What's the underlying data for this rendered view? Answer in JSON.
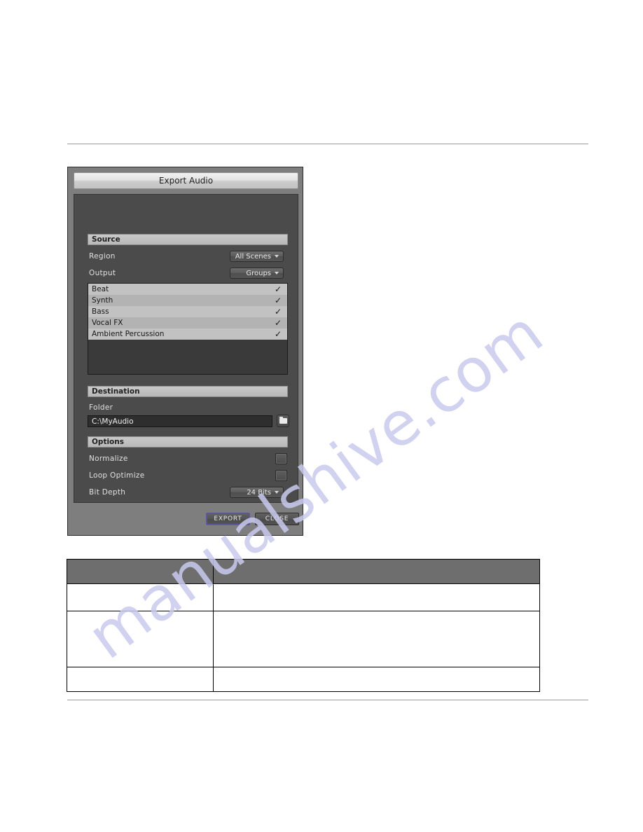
{
  "watermark": {
    "text": "manualshive.com",
    "color": "#c9c9ee"
  },
  "dialog": {
    "title": "Export Audio",
    "sections": {
      "source": {
        "header": "Source",
        "region": {
          "label": "Region",
          "value": "All Scenes",
          "caret_icon": "chevron-down-icon"
        },
        "output": {
          "label": "Output",
          "value": "Groups",
          "caret_icon": "chevron-down-icon"
        },
        "group_list": [
          {
            "name": "Beat",
            "checked": true,
            "check_icon": "checkmark-icon"
          },
          {
            "name": "Synth",
            "checked": true,
            "check_icon": "checkmark-icon"
          },
          {
            "name": "Bass",
            "checked": true,
            "check_icon": "checkmark-icon"
          },
          {
            "name": "Vocal FX",
            "checked": true,
            "check_icon": "checkmark-icon"
          },
          {
            "name": "Ambient Percussion",
            "checked": true,
            "check_icon": "checkmark-icon"
          }
        ]
      },
      "destination": {
        "header": "Destination",
        "folder": {
          "label": "Folder",
          "value": "C:\\MyAudio",
          "browse_icon": "folder-icon"
        }
      },
      "options": {
        "header": "Options",
        "normalize": {
          "label": "Normalize",
          "checked": false
        },
        "loop_optimize": {
          "label": "Loop Optimize",
          "checked": false
        },
        "bit_depth": {
          "label": "Bit Depth",
          "value": "24 Bits",
          "caret_icon": "chevron-down-icon"
        }
      }
    },
    "progress": {
      "percent": 0
    },
    "footer": {
      "export_label": "EXPORT",
      "close_label": "CLOSE",
      "export_focus_color": "#5a56a0"
    }
  },
  "table": {
    "headers": [
      "",
      ""
    ],
    "rows": [
      [
        "",
        ""
      ],
      [
        "",
        ""
      ],
      [
        "",
        ""
      ]
    ]
  }
}
